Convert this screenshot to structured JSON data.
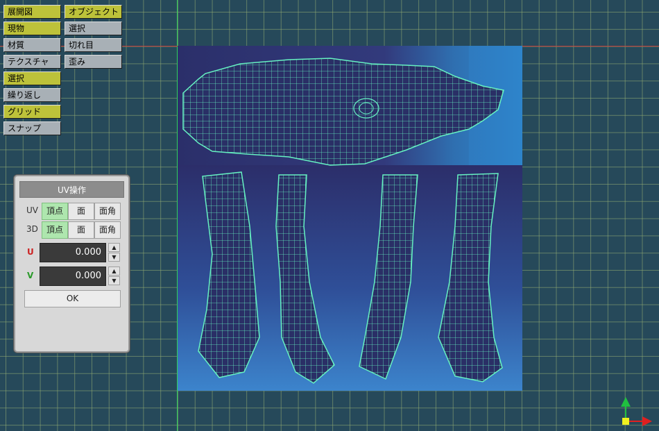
{
  "toolbar_left": [
    {
      "label": "展開図",
      "on": true
    },
    {
      "label": "現物",
      "on": true
    },
    {
      "label": "材質",
      "on": false
    },
    {
      "label": "テクスチャ",
      "on": false
    },
    {
      "label": "選択",
      "on": true
    },
    {
      "label": "繰り返し",
      "on": false
    },
    {
      "label": "グリッド",
      "on": true
    },
    {
      "label": "スナップ",
      "on": false
    }
  ],
  "toolbar_right": [
    {
      "label": "オブジェクト",
      "on": true
    },
    {
      "label": "選択",
      "on": false
    },
    {
      "label": "切れ目",
      "on": false
    },
    {
      "label": "歪み",
      "on": false
    }
  ],
  "uv_panel": {
    "title": "UV操作",
    "uv_row_label": "UV",
    "row3d_label": "3D",
    "modes": [
      "頂点",
      "面",
      "面角"
    ],
    "active_mode": "頂点",
    "u_label": "U",
    "v_label": "V",
    "u_value": "0.000",
    "v_value": "0.000",
    "ok_label": "OK"
  },
  "colors": {
    "button_on": "#bdc23a",
    "button_off": "#a8b0b6",
    "wire": "#66f2c2",
    "axis_x": "#e02020",
    "axis_y": "#20c040"
  }
}
